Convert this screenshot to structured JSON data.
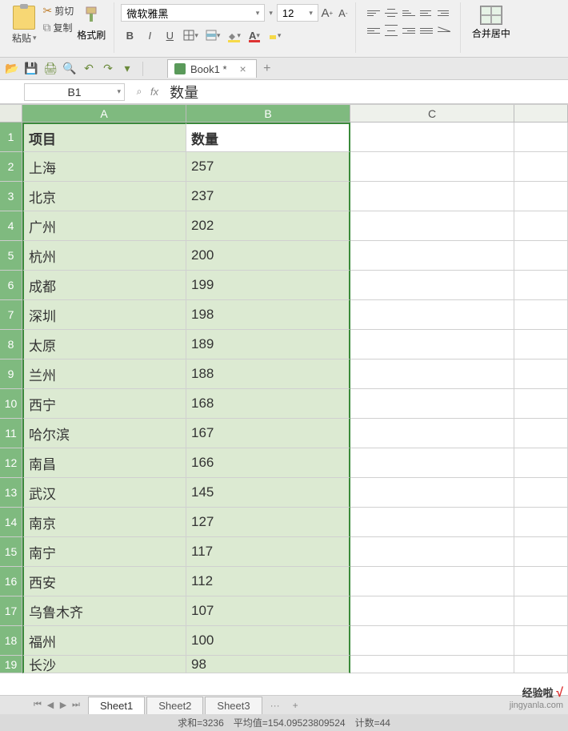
{
  "ribbon": {
    "paste_label": "粘贴",
    "cut_label": "剪切",
    "copy_label": "复制",
    "format_painter_label": "格式刷",
    "font_name": "微软雅黑",
    "font_size": "12",
    "bold": "B",
    "italic": "I",
    "underline": "U",
    "merge_label": "合并居中"
  },
  "doc": {
    "tab_title": "Book1 *"
  },
  "namebox": {
    "cell_ref": "B1",
    "formula": "数量"
  },
  "columns": {
    "A": "A",
    "B": "B",
    "C": "C"
  },
  "chart_data": {
    "type": "table",
    "title": "",
    "columns": [
      "项目",
      "数量"
    ],
    "rows": [
      {
        "项目": "上海",
        "数量": 257
      },
      {
        "项目": "北京",
        "数量": 237
      },
      {
        "项目": "广州",
        "数量": 202
      },
      {
        "项目": "杭州",
        "数量": 200
      },
      {
        "项目": "成都",
        "数量": 199
      },
      {
        "项目": "深圳",
        "数量": 198
      },
      {
        "项目": "太原",
        "数量": 189
      },
      {
        "项目": "兰州",
        "数量": 188
      },
      {
        "项目": "西宁",
        "数量": 168
      },
      {
        "项目": "哈尔滨",
        "数量": 167
      },
      {
        "项目": "南昌",
        "数量": 166
      },
      {
        "项目": "武汉",
        "数量": 145
      },
      {
        "项目": "南京",
        "数量": 127
      },
      {
        "项目": "南宁",
        "数量": 117
      },
      {
        "项目": "西安",
        "数量": 112
      },
      {
        "项目": "乌鲁木齐",
        "数量": 107
      },
      {
        "项目": "福州",
        "数量": 100
      },
      {
        "项目": "长沙",
        "数量": 98
      }
    ]
  },
  "sheets": {
    "s1": "Sheet1",
    "s2": "Sheet2",
    "s3": "Sheet3",
    "more": "···",
    "add": "+"
  },
  "status": {
    "sum_label": "求和=3236",
    "avg_label": "平均值=154.09523809524",
    "count_label": "计数=44"
  },
  "watermark": {
    "line1a": "经验啦",
    "line1b": "√",
    "line2": "jingyanla.com"
  }
}
